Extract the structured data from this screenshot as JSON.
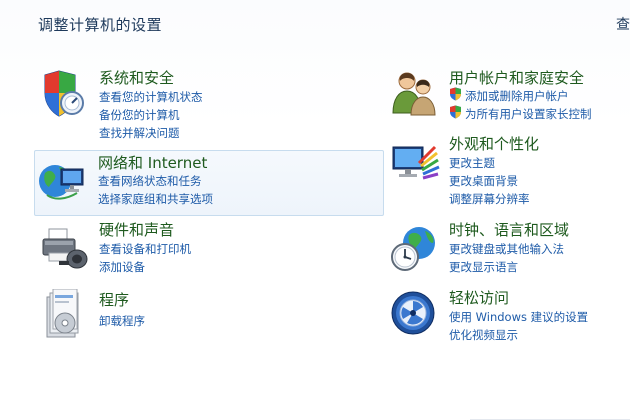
{
  "header": {
    "title": "调整计算机的设置",
    "view_by": "查"
  },
  "categories": [
    {
      "title": "系统和安全",
      "icon": "shield-icon",
      "links": [
        "查看您的计算机状态",
        "备份您的计算机",
        "查找并解决问题"
      ]
    },
    {
      "title": "网络和 Internet",
      "icon": "globe-network-icon",
      "links": [
        "查看网络状态和任务",
        "选择家庭组和共享选项"
      ]
    },
    {
      "title": "硬件和声音",
      "icon": "printer-icon",
      "links": [
        "查看设备和打印机",
        "添加设备"
      ]
    },
    {
      "title": "程序",
      "icon": "programs-icon",
      "links": [
        "卸载程序"
      ]
    },
    {
      "title": "用户帐户和家庭安全",
      "icon": "users-icon",
      "links": [
        "添加或删除用户帐户",
        "为所有用户设置家长控制"
      ]
    },
    {
      "title": "外观和个性化",
      "icon": "monitor-palette-icon",
      "links": [
        "更改主题",
        "更改桌面背景",
        "调整屏幕分辨率"
      ]
    },
    {
      "title": "时钟、语言和区域",
      "icon": "clock-globe-icon",
      "links": [
        "更改键盘或其他输入法",
        "更改显示语言"
      ]
    },
    {
      "title": "轻松访问",
      "icon": "ease-of-access-icon",
      "links": [
        "使用 Windows 建议的设置",
        "优化视频显示"
      ]
    }
  ]
}
